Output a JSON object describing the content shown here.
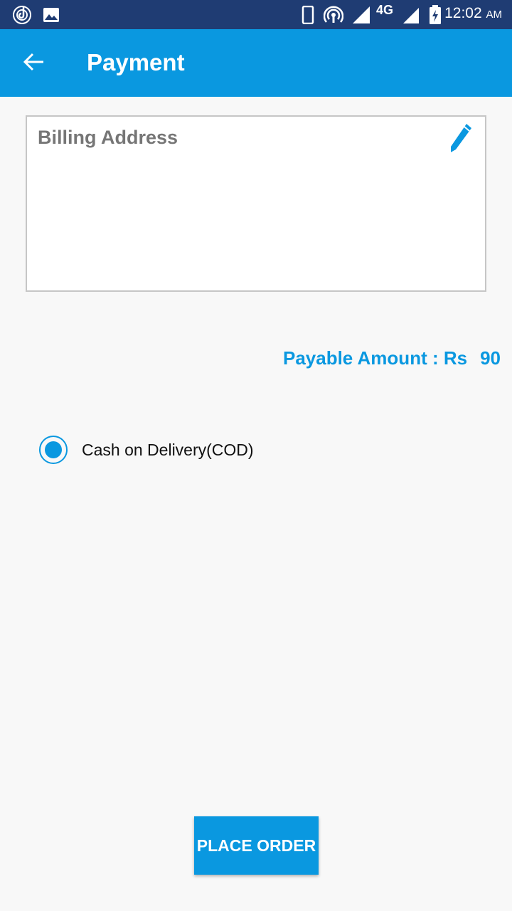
{
  "status_bar": {
    "time": "12:02",
    "ampm": "AM",
    "network": "4G",
    "icons": [
      "music-app-icon",
      "gallery-icon",
      "phone-device-icon",
      "hotspot-icon",
      "signal-icon",
      "signal-icon",
      "battery-charging-icon"
    ]
  },
  "app_bar": {
    "title": "Payment",
    "back_icon": "arrow-left-icon"
  },
  "billing": {
    "title": "Billing Address",
    "edit_icon": "pencil-icon"
  },
  "payment": {
    "payable_label": "Payable Amount : Rs",
    "payable_amount": "90",
    "methods": [
      {
        "label": "Cash on Delivery(COD)",
        "selected": true
      }
    ]
  },
  "actions": {
    "place_order_label": "PLACE ORDER"
  },
  "colors": {
    "status_bar": "#1f3c73",
    "primary": "#0a98e0",
    "background": "#f8f8f8",
    "billing_title": "#767676"
  }
}
